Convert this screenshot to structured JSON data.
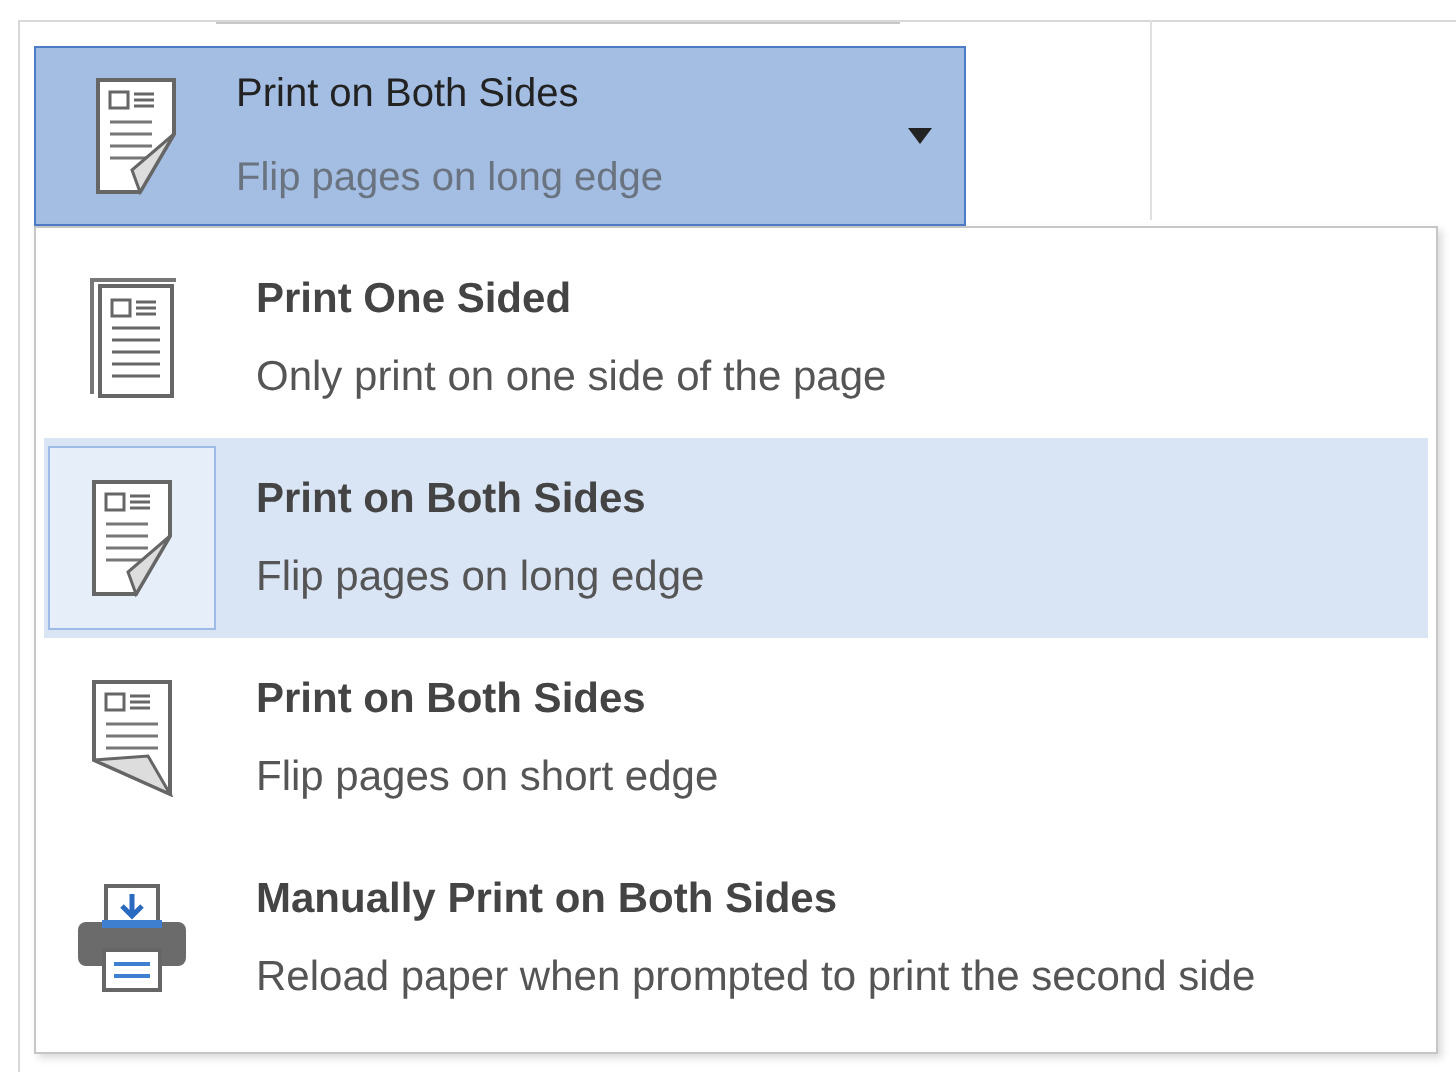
{
  "dropdown": {
    "kind": "long-edge",
    "title": "Print on Both Sides",
    "subtitle": "Flip pages on long edge"
  },
  "options": [
    {
      "kind": "one-sided",
      "title": "Print One Sided",
      "subtitle": "Only print on one side of the page",
      "selected": false
    },
    {
      "kind": "long-edge",
      "title": "Print on Both Sides",
      "subtitle": "Flip pages on long edge",
      "selected": true
    },
    {
      "kind": "short-edge",
      "title": "Print on Both Sides",
      "subtitle": "Flip pages on short edge",
      "selected": false
    },
    {
      "kind": "manual",
      "title": "Manually Print on Both Sides",
      "subtitle": "Reload paper when prompted to print the second side",
      "selected": false
    }
  ]
}
